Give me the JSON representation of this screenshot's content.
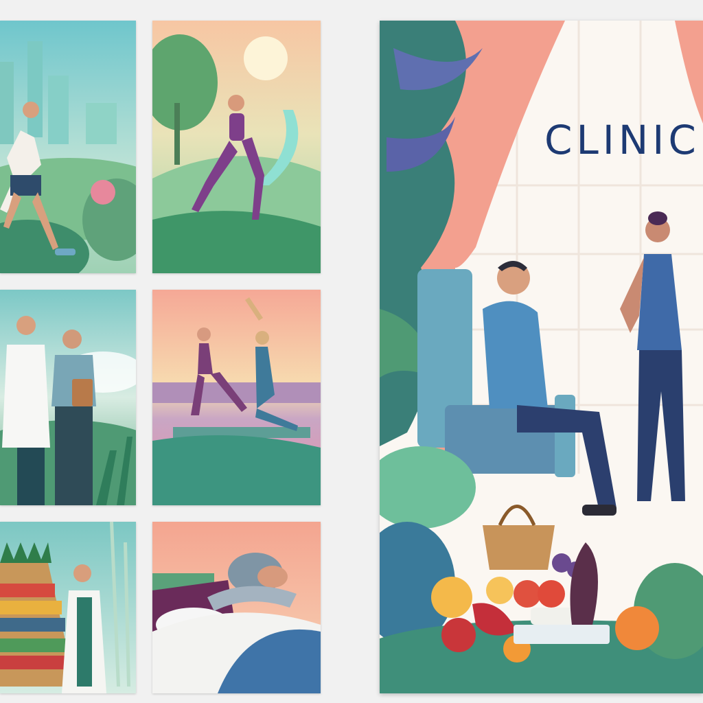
{
  "gallery": {
    "tiles": [
      {
        "name": "city-park-jogging-illustration"
      },
      {
        "name": "sunrise-jogging-illustration"
      },
      {
        "name": "doctor-nurse-consult-illustration"
      },
      {
        "name": "yoga-stretching-illustration"
      },
      {
        "name": "healthy-food-market-illustration"
      },
      {
        "name": "sleep-rest-illustration"
      }
    ]
  },
  "poster": {
    "title": "CLINIC",
    "scene": "clinic-consultation-illustration"
  },
  "colors": {
    "page_background": "#f1f1f1",
    "title_color": "#1d3a73",
    "curtain": "#f3a08f",
    "foliage": "#3f8f7a",
    "sky_peach": "#f7c7a8"
  }
}
